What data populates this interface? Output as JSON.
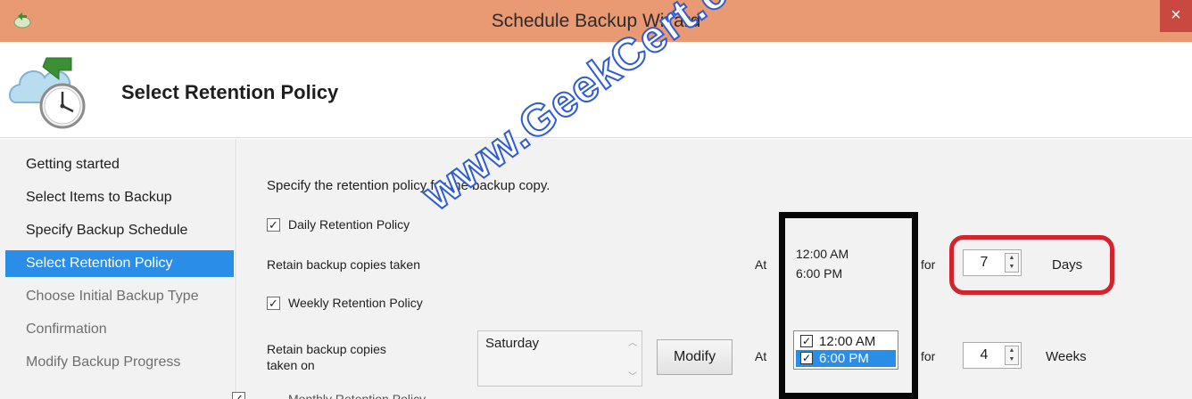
{
  "window": {
    "title": "Schedule Backup Wizard",
    "close_glyph": "×"
  },
  "header": {
    "title": "Select Retention Policy",
    "icon": "cloud-backup-clock-icon"
  },
  "sidebar": {
    "items": [
      {
        "label": "Getting started",
        "state": "normal"
      },
      {
        "label": "Select Items to Backup",
        "state": "normal"
      },
      {
        "label": "Specify Backup Schedule",
        "state": "normal"
      },
      {
        "label": "Select Retention Policy",
        "state": "selected"
      },
      {
        "label": "Choose Initial Backup Type",
        "state": "disabled"
      },
      {
        "label": "Confirmation",
        "state": "disabled"
      },
      {
        "label": "Modify Backup Progress",
        "state": "disabled"
      }
    ]
  },
  "content": {
    "intro": "Specify the retention policy for the backup copy.",
    "daily": {
      "checkbox_label": "Daily Retention Policy",
      "checked": true,
      "row_label": "Retain backup copies taken",
      "at_label": "At",
      "times": [
        "12:00 AM",
        "6:00 PM"
      ],
      "for_label": "for",
      "value": "7",
      "unit": "Days"
    },
    "weekly": {
      "checkbox_label": "Weekly Retention Policy",
      "checked": true,
      "row_label_line1": "Retain backup copies",
      "row_label_line2": "taken on",
      "day_list": [
        "Saturday"
      ],
      "modify_button": "Modify",
      "at_label": "At",
      "time_options": [
        {
          "label": "12:00 AM",
          "checked": true,
          "selected": false
        },
        {
          "label": "6:00 PM",
          "checked": true,
          "selected": true
        }
      ],
      "for_label": "for",
      "value": "4",
      "unit": "Weeks"
    },
    "monthly": {
      "checkbox_label": "Monthly Retention Policy",
      "checked": true
    }
  },
  "annotations": {
    "watermark": "www.GeekCert.com",
    "highlight_colors": {
      "black_box": "#080808",
      "red_box": "#d4232c"
    }
  },
  "colors": {
    "titlebar": "#ea9a73",
    "selection": "#2a8ee9",
    "panel": "#f2f2f2",
    "watermark_stroke": "#2f5bd3"
  }
}
